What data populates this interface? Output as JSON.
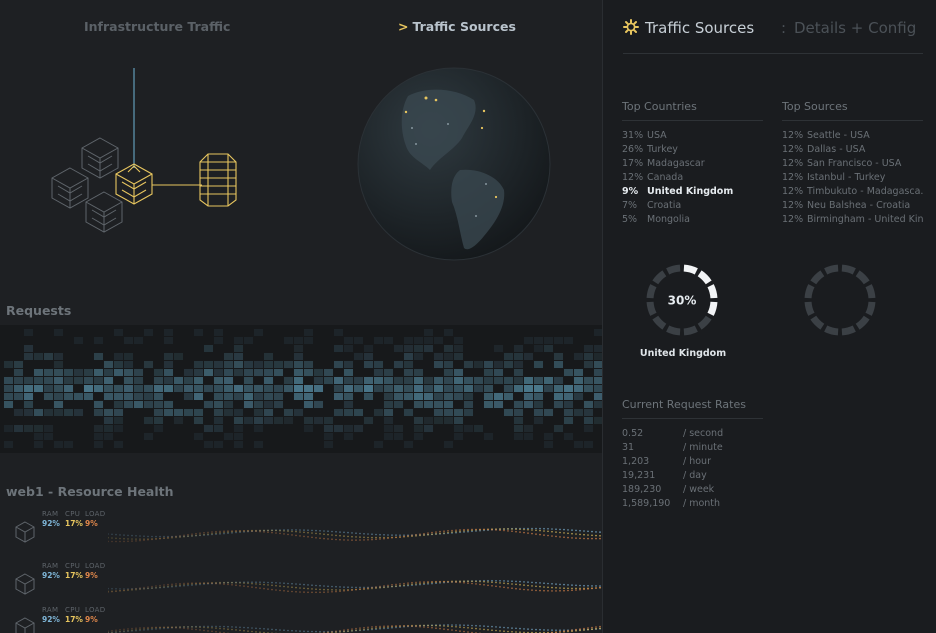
{
  "nav": {
    "infrastructure_label": "Infrastructure Traffic",
    "sources_label": "Traffic Sources",
    "sources_chevron": ">"
  },
  "sections": {
    "requests_title": "Requests",
    "health_title": "web1 - Resource Health"
  },
  "health_rows": [
    {
      "ram_label": "RAM",
      "cpu_label": "CPU",
      "load_label": "LOAD",
      "ram": "92%",
      "cpu": "17%",
      "load": "9%"
    },
    {
      "ram_label": "RAM",
      "cpu_label": "CPU",
      "load_label": "LOAD",
      "ram": "92%",
      "cpu": "17%",
      "load": "9%"
    },
    {
      "ram_label": "RAM",
      "cpu_label": "CPU",
      "load_label": "LOAD",
      "ram": "92%",
      "cpu": "17%",
      "load": "9%"
    }
  ],
  "panel": {
    "title": "Traffic Sources",
    "separator": ":",
    "subtitle": "Details + Config",
    "top_countries_title": "Top Countries",
    "top_countries": [
      {
        "pct": "31%",
        "name": "USA"
      },
      {
        "pct": "26%",
        "name": "Turkey"
      },
      {
        "pct": "17%",
        "name": "Madagascar"
      },
      {
        "pct": "12%",
        "name": "Canada"
      },
      {
        "pct": "9%",
        "name": "United Kingdom",
        "active": true
      },
      {
        "pct": "7%",
        "name": "Croatia"
      },
      {
        "pct": "5%",
        "name": "Mongolia"
      }
    ],
    "top_sources_title": "Top Sources",
    "top_sources": [
      {
        "pct": "12%",
        "name": "Seattle - USA"
      },
      {
        "pct": "12%",
        "name": "Dallas - USA"
      },
      {
        "pct": "12%",
        "name": "San Francisco - USA"
      },
      {
        "pct": "12%",
        "name": "Istanbul - Turkey"
      },
      {
        "pct": "12%",
        "name": "Timbukuto - Madagasca..."
      },
      {
        "pct": "12%",
        "name": "Neu Balshea - Croatia"
      },
      {
        "pct": "12%",
        "name": "Birmingham - United Kin..."
      }
    ],
    "donut": {
      "value_text": "30%",
      "fraction": 0.3,
      "label": "United Kingdom"
    },
    "rates_title": "Current Request Rates",
    "rates": [
      {
        "value": "0.52",
        "unit": "/ second"
      },
      {
        "value": "31",
        "unit": "/ minute"
      },
      {
        "value": "1,203",
        "unit": "/ hour"
      },
      {
        "value": "19,231",
        "unit": "/ day"
      },
      {
        "value": "189,230",
        "unit": "/ week"
      },
      {
        "value": "1,589,190",
        "unit": "/ month"
      }
    ]
  },
  "colors": {
    "accent_gold": "#e8c65f",
    "accent_blue": "#7fb6d8",
    "accent_orange": "#e0874b",
    "heat_cell": "#4e7d92"
  },
  "icons": {
    "gear": "gear-icon",
    "server": "server-icon",
    "database": "database-icon",
    "globe": "globe-icon"
  }
}
